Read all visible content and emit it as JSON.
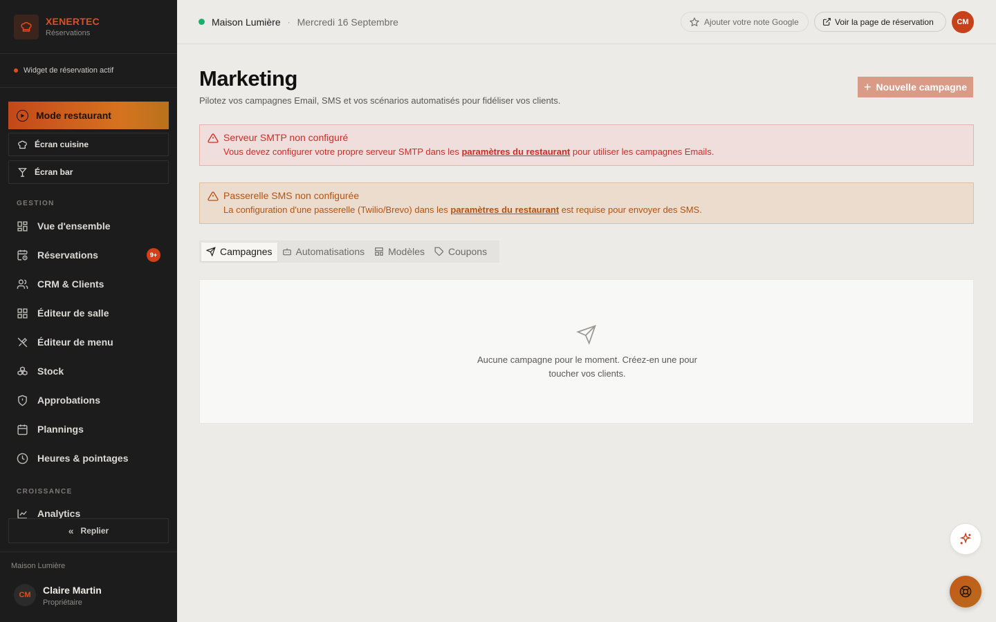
{
  "brand": {
    "name": "XENERTEC",
    "subtitle": "Réservations"
  },
  "sidebar": {
    "widget_status": "Widget de réservation actif",
    "mode_button": "Mode restaurant",
    "kitchen_screen": "Écran cuisine",
    "bar_screen": "Écran bar",
    "section_gestion": "GESTION",
    "items": [
      {
        "label": "Vue d'ensemble",
        "icon": "dashboard-icon"
      },
      {
        "label": "Réservations",
        "icon": "calendar-clock-icon",
        "badge": "9+"
      },
      {
        "label": "CRM & Clients",
        "icon": "users-icon"
      },
      {
        "label": "Éditeur de salle",
        "icon": "grid-icon"
      },
      {
        "label": "Éditeur de menu",
        "icon": "utensils-icon"
      },
      {
        "label": "Stock",
        "icon": "boxes-icon"
      },
      {
        "label": "Approbations",
        "icon": "shield-icon"
      },
      {
        "label": "Plannings",
        "icon": "calendar-icon"
      },
      {
        "label": "Heures & pointages",
        "icon": "clock-icon"
      }
    ],
    "section_croissance": "CROISSANCE",
    "analytics": "Analytics",
    "collapse": "Replier",
    "footer_restaurant": "Maison Lumière",
    "user": {
      "initials": "CM",
      "name": "Claire Martin",
      "role": "Propriétaire"
    }
  },
  "topbar": {
    "restaurant": "Maison Lumière",
    "separator": "·",
    "date": "Mercredi 16 Septembre",
    "google_button": "Ajouter votre note Google",
    "booking_button": "Voir la page de réservation",
    "avatar_initials": "CM"
  },
  "main": {
    "title": "Marketing",
    "subtitle": "Pilotez vos campagnes Email, SMS et vos scénarios automatisés pour fidéliser vos clients.",
    "new_campaign": "Nouvelle campagne",
    "alert_smtp": {
      "title": "Serveur SMTP non configuré",
      "text_before": "Vous devez configurer votre propre serveur SMTP dans les ",
      "link": "paramètres du restaurant",
      "text_after": " pour utiliser les campagnes Emails."
    },
    "alert_sms": {
      "title": "Passerelle SMS non configurée",
      "text_before": "La configuration d'une passerelle (Twilio/Brevo) dans les ",
      "link": "paramètres du restaurant",
      "text_after": " est requise pour envoyer des SMS."
    },
    "tabs": [
      {
        "label": "Campagnes",
        "icon": "send-icon",
        "active": true
      },
      {
        "label": "Automatisations",
        "icon": "bot-icon"
      },
      {
        "label": "Modèles",
        "icon": "template-icon"
      },
      {
        "label": "Coupons",
        "icon": "tag-icon"
      }
    ],
    "empty_state": "Aucune campagne pour le moment. Créez-en une pour toucher vos clients."
  },
  "colors": {
    "accent": "#e24d1c",
    "sidebar_bg": "#1c1c1c",
    "success": "#17b26a",
    "error": "#d02a26",
    "warning": "#b8510d"
  }
}
